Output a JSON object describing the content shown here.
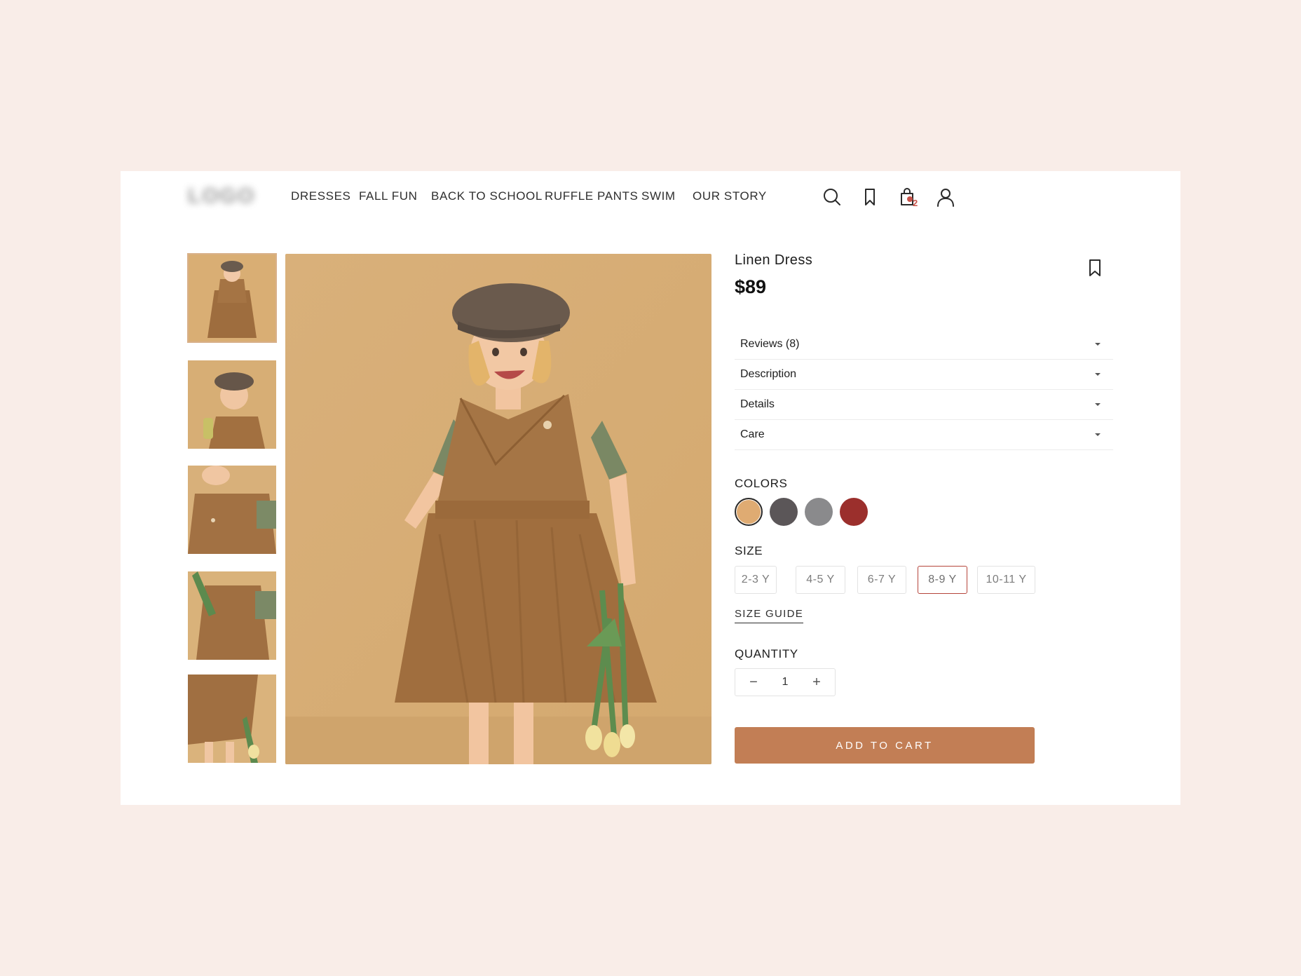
{
  "header": {
    "logo_text": "LOGO",
    "nav": [
      {
        "label": "DRESSES"
      },
      {
        "label": "FALL FUN"
      },
      {
        "label": "BACK TO SCHOOL"
      },
      {
        "label": "RUFFLE PANTS"
      },
      {
        "label": "SWIM"
      },
      {
        "label": "OUR STORY"
      }
    ],
    "icons": [
      "search-icon",
      "bookmark-icon",
      "shopping-bag-icon",
      "user-icon"
    ],
    "cart_count": "2"
  },
  "gallery": {
    "thumbnails": 5,
    "active_thumbnail": 0
  },
  "product": {
    "name": "Linen Dress",
    "price": "$89"
  },
  "accordion": [
    {
      "label": "Reviews (8)"
    },
    {
      "label": "Description"
    },
    {
      "label": "Details"
    },
    {
      "label": "Care"
    }
  ],
  "colors": {
    "label": "COLORS",
    "swatches": [
      {
        "hex": "#dfab72",
        "selected": true
      },
      {
        "hex": "#5b5658",
        "selected": false
      },
      {
        "hex": "#8a8a8c",
        "selected": false
      },
      {
        "hex": "#9b2f2c",
        "selected": false
      }
    ]
  },
  "size": {
    "label": "SIZE",
    "options": [
      {
        "label": "2-3 Y",
        "selected": false
      },
      {
        "label": "4-5 Y",
        "selected": false
      },
      {
        "label": "6-7 Y",
        "selected": false
      },
      {
        "label": "8-9 Y",
        "selected": true
      },
      {
        "label": "10-11 Y",
        "selected": false
      }
    ],
    "guide_label": "SIZE GUIDE"
  },
  "quantity": {
    "label": "QUANTITY",
    "value": "1",
    "minus": "−",
    "plus": "+"
  },
  "cta": {
    "label": "ADD TO CART",
    "color": "#c27e55"
  },
  "palette": {
    "page_bg": "#f9ede8",
    "photo_bg": "#dcb47a",
    "dress": "#a0703f"
  }
}
